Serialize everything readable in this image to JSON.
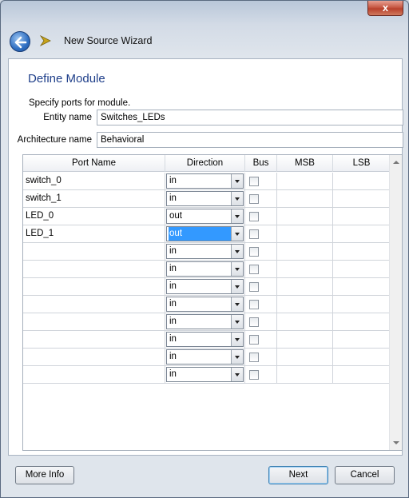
{
  "window": {
    "title": "New Source Wizard",
    "close_glyph": "x"
  },
  "page": {
    "heading": "Define Module",
    "hint": "Specify ports for module.",
    "entity_label": "Entity name",
    "entity_value": "Switches_LEDs",
    "arch_label": "Architecture name",
    "arch_value": "Behavioral"
  },
  "table": {
    "headers": [
      "Port Name",
      "Direction",
      "Bus",
      "MSB",
      "LSB"
    ],
    "rows": [
      {
        "name": "switch_0",
        "direction": "in"
      },
      {
        "name": "switch_1",
        "direction": "in"
      },
      {
        "name": "LED_0",
        "direction": "out"
      },
      {
        "name": "LED_1",
        "direction": "out"
      },
      {
        "name": "",
        "direction": "in"
      },
      {
        "name": "",
        "direction": "in"
      },
      {
        "name": "",
        "direction": "in"
      },
      {
        "name": "",
        "direction": "in"
      },
      {
        "name": "",
        "direction": "in"
      },
      {
        "name": "",
        "direction": "in"
      },
      {
        "name": "",
        "direction": "in"
      },
      {
        "name": "",
        "direction": "in"
      }
    ],
    "selected_row": 3
  },
  "buttons": {
    "more_info": "More Info",
    "next": "Next",
    "cancel": "Cancel"
  },
  "icons": {
    "back": "back-arrow-icon",
    "wizard": "wizard-arrow-icon"
  },
  "colors": {
    "accent": "#3399ff",
    "heading": "#1f3f8a"
  }
}
